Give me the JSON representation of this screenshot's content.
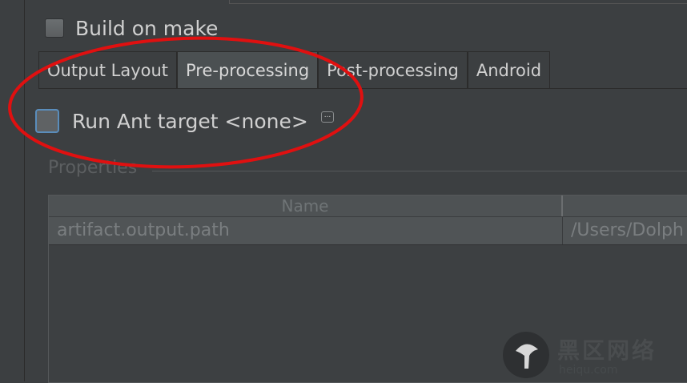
{
  "build_on_make": {
    "label": "Build on make",
    "checked": false
  },
  "tabs": [
    {
      "label": "Output Layout",
      "selected": false
    },
    {
      "label": "Pre-processing",
      "selected": true
    },
    {
      "label": "Post-processing",
      "selected": false
    },
    {
      "label": "Android",
      "selected": false
    }
  ],
  "run_ant": {
    "label": "Run Ant target <none>",
    "checked": false,
    "more_label": "..."
  },
  "properties": {
    "title": "Properties",
    "columns": [
      "Name",
      ""
    ],
    "rows": [
      {
        "name": "artifact.output.path",
        "value": "/Users/Dolph"
      }
    ]
  },
  "watermark": {
    "text": "黑区网络",
    "sub": "heiqu.com"
  },
  "colors": {
    "annotation": "#e01010",
    "background": "#3c3f41",
    "focus": "#5a8dbb"
  }
}
